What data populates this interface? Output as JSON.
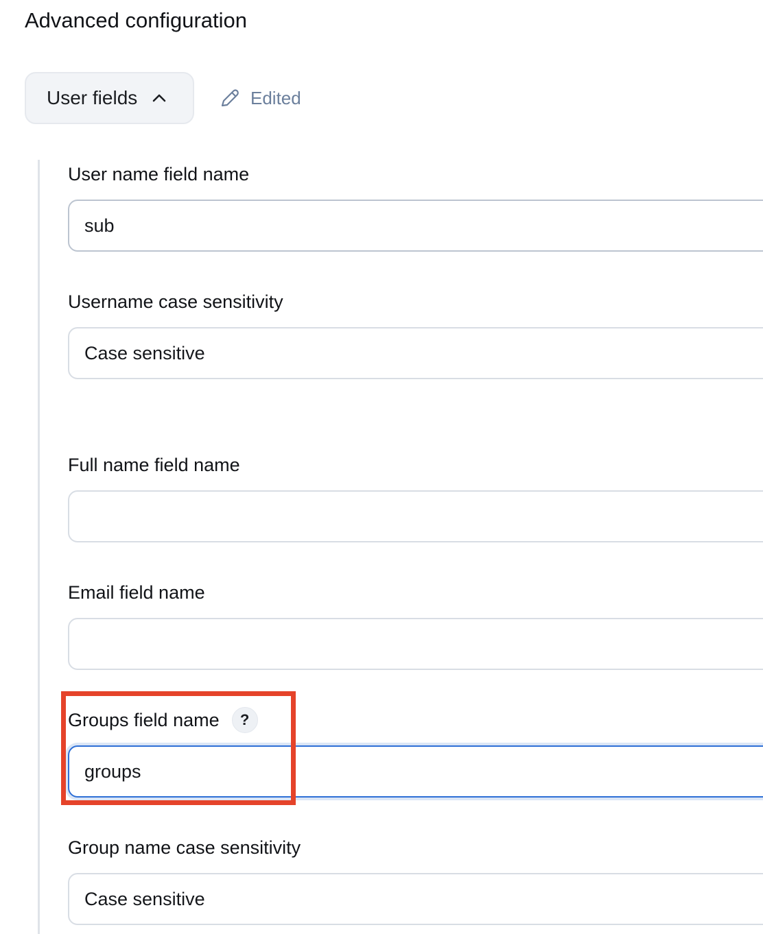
{
  "section": {
    "title": "Advanced configuration",
    "toggle_label": "User fields",
    "toggle_icon": "chevron-up-icon",
    "edited_label": "Edited",
    "edited_icon": "pencil-icon"
  },
  "fields": {
    "username": {
      "label": "User name field name",
      "value": "sub"
    },
    "username_case": {
      "label": "Username case sensitivity",
      "value": "Case sensitive"
    },
    "full_name": {
      "label": "Full name field name",
      "value": ""
    },
    "email": {
      "label": "Email field name",
      "value": ""
    },
    "groups": {
      "label": "Groups field name",
      "value": "groups",
      "help_glyph": "?"
    },
    "group_case": {
      "label": "Group name case sensitivity",
      "value": "Case sensitive"
    }
  },
  "colors": {
    "accent_focus": "#2d6fd6",
    "edited_text": "#6b7f9c",
    "highlight": "#e5432a"
  }
}
